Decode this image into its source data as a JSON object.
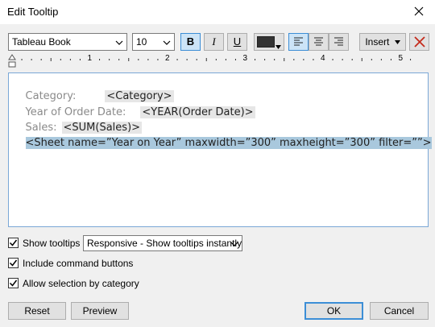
{
  "window": {
    "title": "Edit Tooltip"
  },
  "toolbar": {
    "font_family": "Tableau Book",
    "font_size": "10",
    "bold_label": "B",
    "italic_label": "I",
    "underline_label": "U",
    "font_color": "#333333",
    "insert_label": "Insert"
  },
  "ruler": {
    "marks": [
      "1",
      "2",
      "3",
      "4",
      "5"
    ]
  },
  "editor": {
    "line1": {
      "label": "Category:",
      "field": "<Category>"
    },
    "line2": {
      "label": "Year of Order Date:",
      "field": "<YEAR(Order Date)>"
    },
    "line3": {
      "label": "Sales:",
      "field": "<SUM(Sales)>"
    },
    "line4": "<Sheet name=”Year on Year” maxwidth=”300” maxheight=”300” filter=””>"
  },
  "options": {
    "show_tooltips": {
      "label": "Show tooltips",
      "checked": true
    },
    "tooltip_mode": "Responsive - Show tooltips instantly",
    "include_command_buttons": {
      "label": "Include command buttons",
      "checked": true
    },
    "allow_selection": {
      "label": "Allow selection by category",
      "checked": true
    }
  },
  "buttons": {
    "reset": "Reset",
    "preview": "Preview",
    "ok": "OK",
    "cancel": "Cancel"
  },
  "colors": {
    "accent": "#3c8ed6",
    "selection": "#a9c8dd",
    "close_red": "#c42b1c"
  }
}
